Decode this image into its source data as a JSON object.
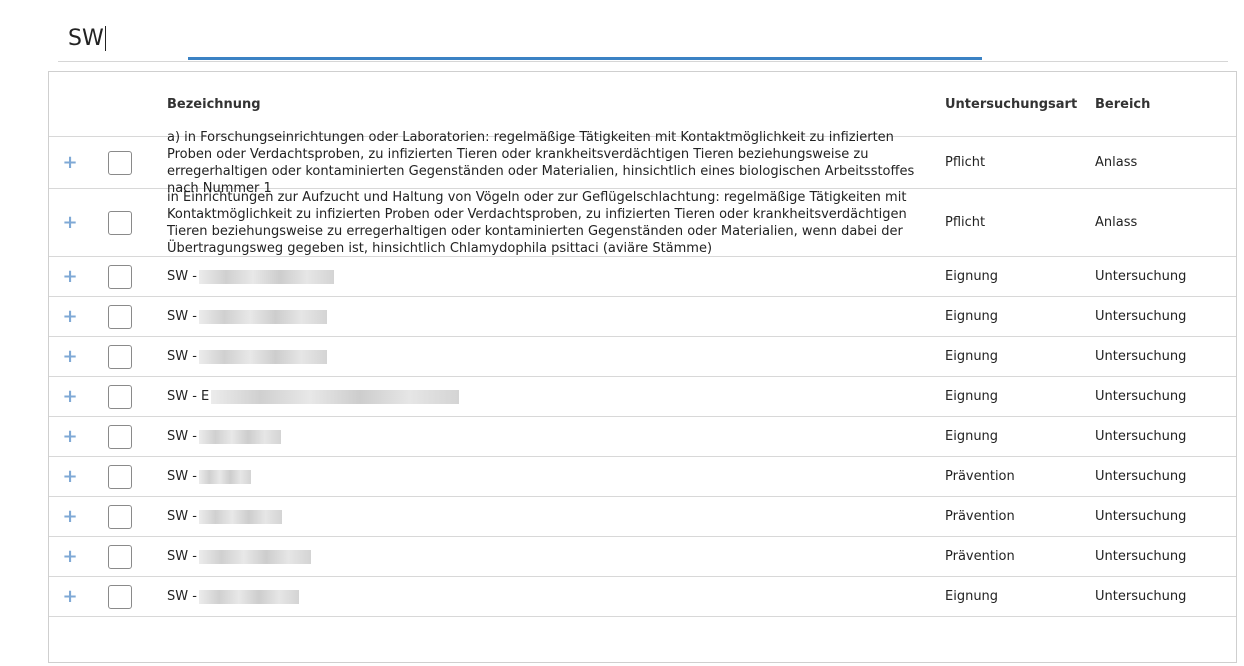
{
  "search": {
    "value": "SW"
  },
  "table": {
    "headers": {
      "expand": "",
      "select": "",
      "name": "Bezeichnung",
      "art": "Untersuchungsart",
      "bereich": "Bereich"
    },
    "rows": [
      {
        "name": "a) in Forschungseinrichtungen oder Laboratorien: regelmäßige Tätigkeiten mit Kontaktmöglichkeit zu infizierten Proben oder Verdachtsproben, zu infizierten Tieren oder krankheitsverdächtigen Tieren beziehungsweise zu erregerhaltigen oder kontaminierten Gegenständen oder Materialien, hinsichtlich eines biologischen Arbeitsstoffes nach Nummer 1",
        "art": "Pflicht",
        "bereich": "Anlass"
      },
      {
        "name": "in Einrichtungen zur Aufzucht und Haltung von Vögeln oder zur Geflügelschlachtung: regelmäßige Tätigkeiten mit Kontaktmöglichkeit zu infizierten Proben oder Verdachtsproben, zu infizierten Tieren oder krankheitsverdächtigen Tieren beziehungsweise zu erregerhaltigen oder kontaminierten Gegenständen oder Materialien, wenn dabei der Übertragungsweg gegeben ist, hinsichtlich Chlamydophila psittaci (aviäre Stämme)",
        "art": "Pflicht",
        "bereich": "Anlass"
      },
      {
        "name": "SW -",
        "art": "Eignung",
        "bereich": "Untersuchung"
      },
      {
        "name": "SW -",
        "art": "Eignung",
        "bereich": "Untersuchung"
      },
      {
        "name": "SW -",
        "art": "Eignung",
        "bereich": "Untersuchung"
      },
      {
        "name": "SW - E",
        "art": "Eignung",
        "bereich": "Untersuchung"
      },
      {
        "name": "SW -",
        "art": "Eignung",
        "bereich": "Untersuchung"
      },
      {
        "name": "SW -",
        "art": "Prävention",
        "bereich": "Untersuchung"
      },
      {
        "name": "SW -",
        "art": "Prävention",
        "bereich": "Untersuchung"
      },
      {
        "name": "SW -",
        "art": "Prävention",
        "bereich": "Untersuchung"
      },
      {
        "name": "SW -",
        "art": "Eignung",
        "bereich": "Untersuchung"
      }
    ],
    "expand_symbol": "+"
  },
  "colors": {
    "accent": "#3b82c4",
    "expand": "#7fa9d6",
    "border": "#d8d8d8"
  }
}
